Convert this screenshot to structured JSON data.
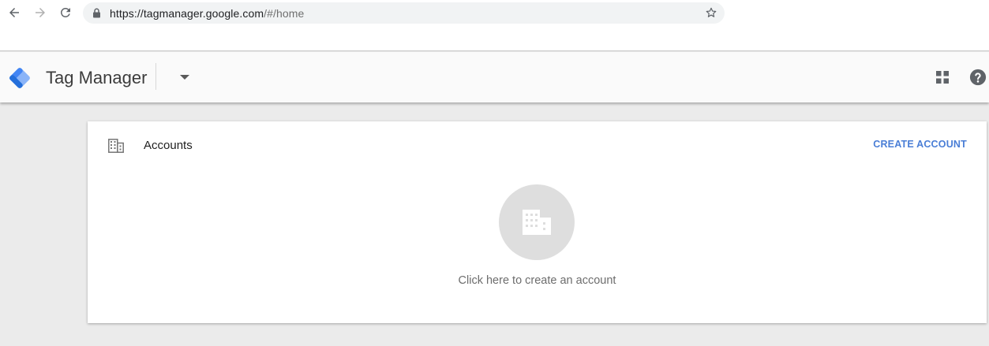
{
  "browser": {
    "url_host": "https://tagmanager.google.com",
    "url_path": "/#/home"
  },
  "header": {
    "title": "Tag Manager"
  },
  "accounts": {
    "title": "Accounts",
    "create_label": "CREATE ACCOUNT",
    "empty_message": "Click here to create an account"
  },
  "icons": {
    "back": "arrow-back-icon",
    "forward": "arrow-forward-icon",
    "reload": "reload-icon",
    "lock": "lock-icon",
    "bookmark": "star-icon",
    "logo": "tag-manager-logo",
    "dropdown": "caret-down-icon",
    "apps": "apps-grid-icon",
    "help": "help-icon",
    "building": "building-icon"
  },
  "colors": {
    "accent": "#4a7ed6",
    "logo_dark": "#4285f4",
    "logo_light": "#8ab4f8"
  }
}
